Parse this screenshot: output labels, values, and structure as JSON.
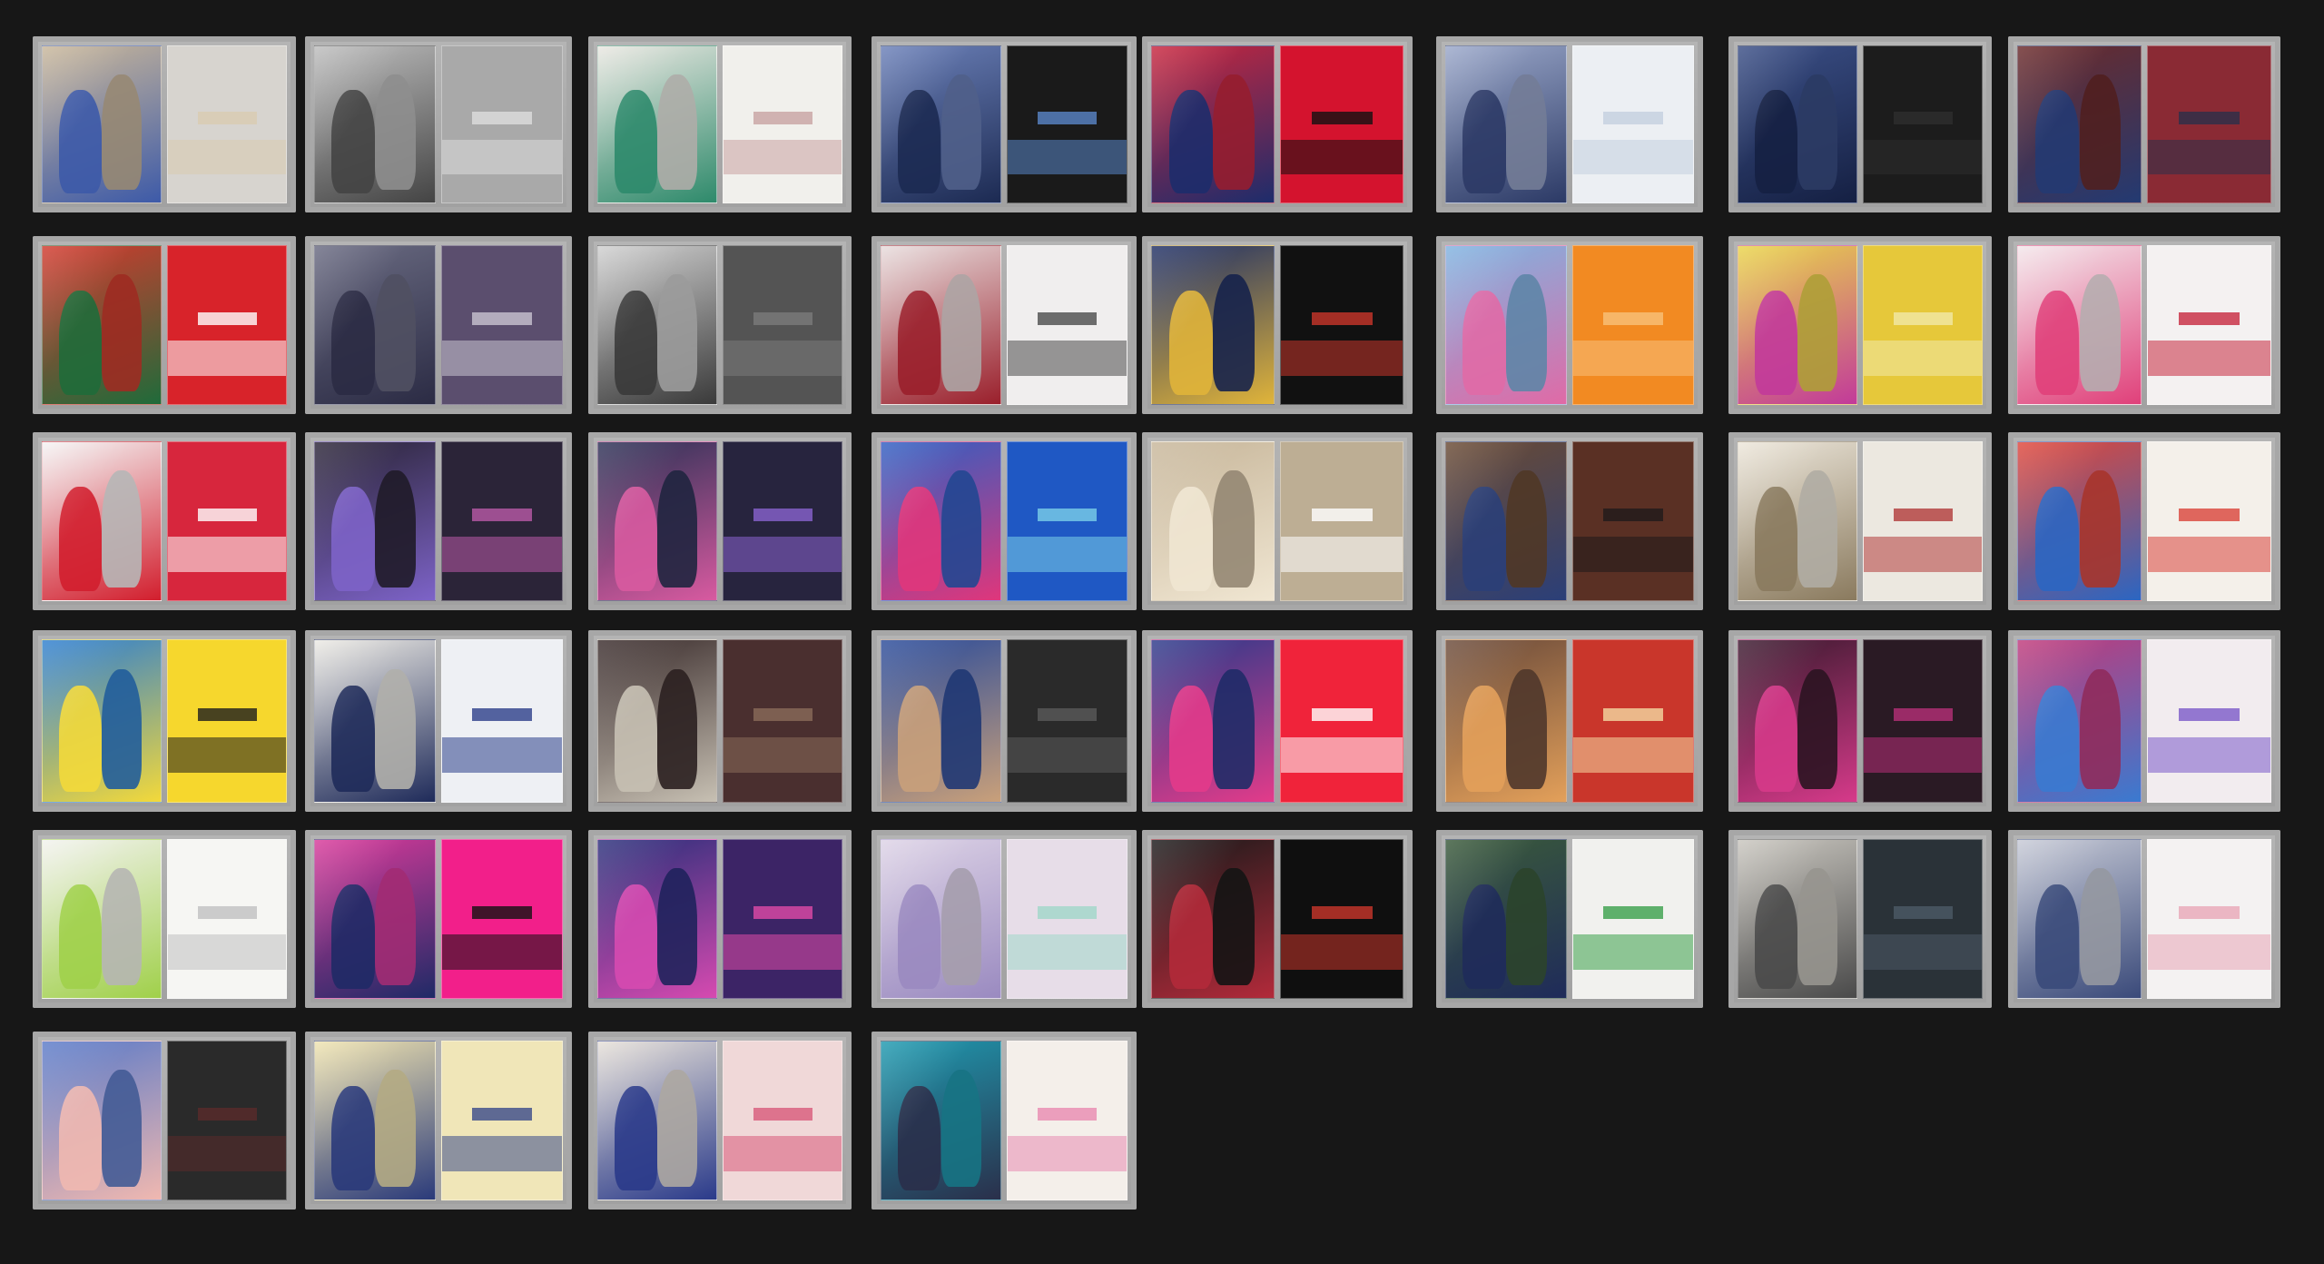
{
  "gallery": {
    "tiles": [
      {
        "row": 0,
        "col": 0,
        "cover": "#c9b79a",
        "accent": "#3d5aa8",
        "back": "#d7d4cf",
        "backAccent": "#d9cbb0"
      },
      {
        "row": 0,
        "col": 1,
        "cover": "#bdbdbd",
        "accent": "#444444",
        "back": "#a9a9a9",
        "backAccent": "#dddddd"
      },
      {
        "row": 0,
        "col": 2,
        "cover": "#e9e7e1",
        "accent": "#2e8a6b",
        "back": "#f1f0ec",
        "backAccent": "#c8a3a3"
      },
      {
        "row": 0,
        "col": 3,
        "cover": "#6b80b8",
        "accent": "#1c2a52",
        "back": "#1a1a1a",
        "backAccent": "#5a86c8"
      },
      {
        "row": 0,
        "col": 4,
        "cover": "#c8263e",
        "accent": "#1d2c6b",
        "back": "#d4132e",
        "backAccent": "#111111"
      },
      {
        "row": 0,
        "col": 5,
        "cover": "#9aa7c9",
        "accent": "#2c3a66",
        "back": "#eceff3",
        "backAccent": "#c4cfdf"
      },
      {
        "row": 0,
        "col": 6,
        "cover": "#3b4f86",
        "accent": "#152043",
        "back": "#1c1c1c",
        "backAccent": "#2e2e2e"
      },
      {
        "row": 0,
        "col": 7,
        "cover": "#6b2a2a",
        "accent": "#233a72",
        "back": "#8a2a34",
        "backAccent": "#2b2f4a"
      },
      {
        "row": 1,
        "col": 0,
        "cover": "#d23a2e",
        "accent": "#1f6b3a",
        "back": "#d8232a",
        "backAccent": "#ffffff"
      },
      {
        "row": 1,
        "col": 1,
        "cover": "#6a6b82",
        "accent": "#2b2b44",
        "back": "#5b4e6e",
        "backAccent": "#c9c4d1"
      },
      {
        "row": 1,
        "col": 2,
        "cover": "#d0d0d0",
        "accent": "#3a3a3a",
        "back": "#545454",
        "backAccent": "#7a7a7a"
      },
      {
        "row": 1,
        "col": 3,
        "cover": "#e7dcdc",
        "accent": "#9a1f2b",
        "back": "#f0eeee",
        "backAccent": "#4b4b4b"
      },
      {
        "row": 1,
        "col": 4,
        "cover": "#1f2f66",
        "accent": "#e0b43a",
        "back": "#111111",
        "backAccent": "#c9362b"
      },
      {
        "row": 1,
        "col": 5,
        "cover": "#7fb3e0",
        "accent": "#e06aa6",
        "back": "#f28a22",
        "backAccent": "#f7c07a"
      },
      {
        "row": 1,
        "col": 6,
        "cover": "#e9d44a",
        "accent": "#c23a9a",
        "back": "#e6c83a",
        "backAccent": "#f1e9a8"
      },
      {
        "row": 1,
        "col": 7,
        "cover": "#f3e6ea",
        "accent": "#e0407a",
        "back": "#f4f1f1",
        "backAccent": "#c7283e"
      },
      {
        "row": 2,
        "col": 0,
        "cover": "#f4f4f4",
        "accent": "#d21e2d",
        "back": "#d7263d",
        "backAccent": "#ffffff"
      },
      {
        "row": 2,
        "col": 1,
        "cover": "#2a2436",
        "accent": "#7d63c8",
        "back": "#2b2438",
        "backAccent": "#ba5aa8"
      },
      {
        "row": 2,
        "col": 2,
        "cover": "#2b3155",
        "accent": "#d85aa0",
        "back": "#27243e",
        "backAccent": "#8a63d0"
      },
      {
        "row": 2,
        "col": 3,
        "cover": "#2f5fc2",
        "accent": "#e0367b",
        "back": "#1f58c4",
        "backAccent": "#7ad0e8"
      },
      {
        "row": 2,
        "col": 4,
        "cover": "#c7b69a",
        "accent": "#f0e6d2",
        "back": "#bdae94",
        "backAccent": "#ffffff"
      },
      {
        "row": 2,
        "col": 5,
        "cover": "#6a4a33",
        "accent": "#2b3f78",
        "back": "#5a3024",
        "backAccent": "#1f1a1a"
      },
      {
        "row": 2,
        "col": 6,
        "cover": "#ece6da",
        "accent": "#8a7a5e",
        "back": "#ece8e0",
        "backAccent": "#b23a3a"
      },
      {
        "row": 2,
        "col": 7,
        "cover": "#e0473a",
        "accent": "#2b66c2",
        "back": "#f4f0ea",
        "backAccent": "#d9433a"
      },
      {
        "row": 3,
        "col": 0,
        "cover": "#2e7ed0",
        "accent": "#f3d93a",
        "back": "#f6d72d",
        "backAccent": "#1d1d1d"
      },
      {
        "row": 3,
        "col": 1,
        "cover": "#eceae4",
        "accent": "#1f2b5a",
        "back": "#eef0f4",
        "backAccent": "#2c3f8a"
      },
      {
        "row": 3,
        "col": 2,
        "cover": "#3a2c2c",
        "accent": "#c7c0b3",
        "back": "#4a2f2f",
        "backAccent": "#8a6b5a"
      },
      {
        "row": 3,
        "col": 3,
        "cover": "#2a4b9a",
        "accent": "#c9a07a",
        "back": "#2a2a2a",
        "backAccent": "#5a5a5a"
      },
      {
        "row": 3,
        "col": 4,
        "cover": "#2b3a8a",
        "accent": "#e33b8a",
        "back": "#f0233a",
        "backAccent": "#ffffff"
      },
      {
        "row": 3,
        "col": 5,
        "cover": "#6a4a3a",
        "accent": "#e3a05a",
        "back": "#c9362b",
        "backAccent": "#f4d9a2"
      },
      {
        "row": 3,
        "col": 6,
        "cover": "#3a1a2e",
        "accent": "#d63a8a",
        "back": "#2a1a24",
        "backAccent": "#b62f78"
      },
      {
        "row": 3,
        "col": 7,
        "cover": "#c03a7a",
        "accent": "#3a7ad0",
        "back": "#f2ecef",
        "backAccent": "#7a5ac8"
      },
      {
        "row": 4,
        "col": 0,
        "cover": "#f2f2ee",
        "accent": "#a0d04a",
        "back": "#f6f6f3",
        "backAccent": "#c0c0c0"
      },
      {
        "row": 4,
        "col": 1,
        "cover": "#d83a9a",
        "accent": "#1f2a66",
        "back": "#f21f8a",
        "backAccent": "#111111"
      },
      {
        "row": 4,
        "col": 2,
        "cover": "#2a2f7a",
        "accent": "#d64ab0",
        "back": "#3c2466",
        "backAccent": "#e04aa8"
      },
      {
        "row": 4,
        "col": 3,
        "cover": "#ddd3e6",
        "accent": "#9a8ac0",
        "back": "#e7dde8",
        "backAccent": "#a0d7c8"
      },
      {
        "row": 4,
        "col": 4,
        "cover": "#1a1a1a",
        "accent": "#b22a3a",
        "back": "#0f0f0f",
        "backAccent": "#c9362b"
      },
      {
        "row": 4,
        "col": 5,
        "cover": "#3a5a3a",
        "accent": "#1f2b5a",
        "back": "#f1f1ee",
        "backAccent": "#3aa04a"
      },
      {
        "row": 4,
        "col": 6,
        "cover": "#c9c6bf",
        "accent": "#4a4a4a",
        "back": "#2a3238",
        "backAccent": "#4c5a66"
      },
      {
        "row": 4,
        "col": 7,
        "cover": "#c7cad6",
        "accent": "#3a4a7a",
        "back": "#f4f2f2",
        "backAccent": "#e8a6b6"
      },
      {
        "row": 5,
        "col": 0,
        "cover": "#5a7ac8",
        "accent": "#f0b8b0",
        "back": "#2a2a2a",
        "backAccent": "#5a2a2a"
      },
      {
        "row": 5,
        "col": 1,
        "cover": "#f0e4b0",
        "accent": "#2a3a7a",
        "back": "#f0e6b8",
        "backAccent": "#3a4a8a"
      },
      {
        "row": 5,
        "col": 2,
        "cover": "#e6e0d8",
        "accent": "#2a3a8a",
        "back": "#f0d8d8",
        "backAccent": "#d85a7a"
      },
      {
        "row": 5,
        "col": 3,
        "cover": "#1f9ab0",
        "accent": "#2a2f4a",
        "back": "#f4efea",
        "backAccent": "#e88ab0"
      }
    ]
  }
}
